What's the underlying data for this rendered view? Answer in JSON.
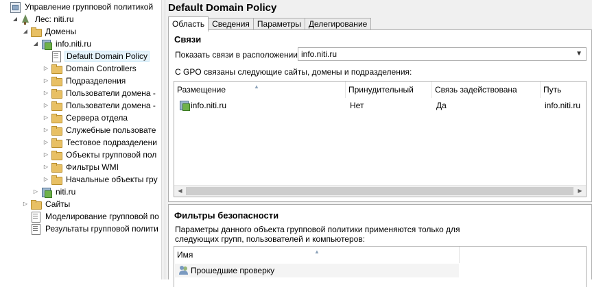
{
  "tree": {
    "items": [
      {
        "label": "Управление групповой политикой",
        "icon": "gpmc-icon",
        "expand": "",
        "level": 0
      },
      {
        "label": "Лес: niti.ru",
        "icon": "forest-icon",
        "expand": "◢",
        "level": 1
      },
      {
        "label": "Домены",
        "icon": "folder-icon",
        "expand": "◢",
        "level": 2
      },
      {
        "label": "info.niti.ru",
        "icon": "domain-icon",
        "expand": "◢",
        "level": 3
      },
      {
        "label": "Default Domain Policy",
        "icon": "gpo-icon",
        "expand": "",
        "level": 4,
        "selected": true
      },
      {
        "label": "Domain Controllers",
        "icon": "folder-icon",
        "expand": "▷",
        "level": 4
      },
      {
        "label": "Подразделения",
        "icon": "folder-icon",
        "expand": "▷",
        "level": 4
      },
      {
        "label": "Пользователи домена -",
        "icon": "folder-icon",
        "expand": "▷",
        "level": 4
      },
      {
        "label": "Пользователи домена -",
        "icon": "folder-icon",
        "expand": "▷",
        "level": 4
      },
      {
        "label": "Сервера отдела",
        "icon": "folder-icon",
        "expand": "▷",
        "level": 4
      },
      {
        "label": "Служебные пользовате",
        "icon": "folder-icon",
        "expand": "▷",
        "level": 4
      },
      {
        "label": "Тестовое подразделени",
        "icon": "folder-icon",
        "expand": "▷",
        "level": 4
      },
      {
        "label": "Объекты групповой пол",
        "icon": "folder-icon",
        "expand": "▷",
        "level": 4
      },
      {
        "label": "Фильтры WMI",
        "icon": "folder-icon",
        "expand": "▷",
        "level": 4
      },
      {
        "label": "Начальные объекты гру",
        "icon": "folder-icon",
        "expand": "▷",
        "level": 4
      },
      {
        "label": "niti.ru",
        "icon": "domain-icon",
        "expand": "▷",
        "level": 3
      },
      {
        "label": "Сайты",
        "icon": "folder-icon",
        "expand": "▷",
        "level": 2
      },
      {
        "label": "Моделирование групповой по",
        "icon": "gpo-icon",
        "expand": "",
        "level": 2
      },
      {
        "label": "Результаты групповой полити",
        "icon": "gpo-icon",
        "expand": "",
        "level": 2
      }
    ]
  },
  "main": {
    "title": "Default Domain Policy",
    "tabs": [
      "Область",
      "Сведения",
      "Параметры",
      "Делегирование"
    ],
    "links": {
      "heading": "Связи",
      "show_label": "Показать связи в расположении:",
      "location_value": "info.niti.ru",
      "description": "С GPO связаны следующие сайты, домены и подразделения:",
      "columns": [
        "Размещение",
        "Принудительный",
        "Связь задействована",
        "Путь"
      ],
      "rows": [
        {
          "place": "info.niti.ru",
          "enforced": "Нет",
          "enabled": "Да",
          "path": "info.niti.ru"
        }
      ]
    },
    "security": {
      "heading": "Фильтры безопасности",
      "description_line1": "Параметры данного объекта групповой политики применяются только для",
      "description_line2": "следующих групп, пользователей и компьютеров:",
      "columns": [
        "Имя"
      ],
      "rows": [
        {
          "name": "Прошедшие проверку"
        }
      ]
    }
  }
}
